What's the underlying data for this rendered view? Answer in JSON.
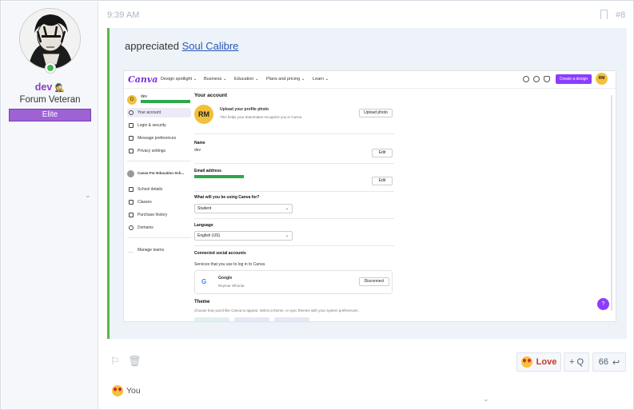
{
  "user": {
    "name": "dev",
    "title": "Forum Veteran",
    "banner": "Elite",
    "avatar_icon": "avatar-image",
    "online": true
  },
  "post": {
    "timestamp": "9:39 AM",
    "number": "#8",
    "action_text": "appreciated",
    "link_text": "Soul Calibre"
  },
  "screenshot": {
    "logo": "Canva",
    "nav": [
      "Design spotlight ⌄",
      "Business ⌄",
      "Education ⌄",
      "Plans and pricing ⌄",
      "Learn ⌄"
    ],
    "create_label": "Create a design",
    "avatar_initials": "RM",
    "sidebar_user": "dev",
    "sidebar_items": [
      "Your account",
      "Login & security",
      "Message preferences",
      "Privacy settings"
    ],
    "team_name": "Canva For Education Sch...",
    "team_items": [
      "School details",
      "Classes",
      "Purchase history",
      "Domains"
    ],
    "manage_teams": "Manage teams",
    "main": {
      "heading": "Your account",
      "photo_title": "Upload your profile photo",
      "photo_sub": "This helps your teammates recognize you in Canva",
      "photo_initials": "RM",
      "upload_label": "Upload photo",
      "name_label": "Name",
      "name_value": "dev",
      "edit_label": "Edit",
      "email_label": "Email address",
      "use_label": "What will you be using Canva for?",
      "use_value": "Student",
      "lang_label": "Language",
      "lang_value": "English (US)",
      "social_heading": "Connected social accounts",
      "social_sub": "Services that you use to log in to Canva",
      "google_name": "Google",
      "google_user": "Reymar Whonta",
      "disconnect_label": "Disconnect",
      "theme_heading": "Theme",
      "theme_sub": "Choose how you'd like Canva to appear. Select a theme, or sync themes with your system preferences."
    },
    "help_label": "?"
  },
  "actions": {
    "love_label": "Love",
    "quote_label": "+ Q",
    "reply_label": "66"
  },
  "reactions": {
    "text": "You"
  },
  "colors": {
    "accent_purple": "#8c3fb9",
    "quote_bar": "#58b84a",
    "quote_bg": "#edf3f8",
    "canva_purple": "#8b3dff"
  }
}
